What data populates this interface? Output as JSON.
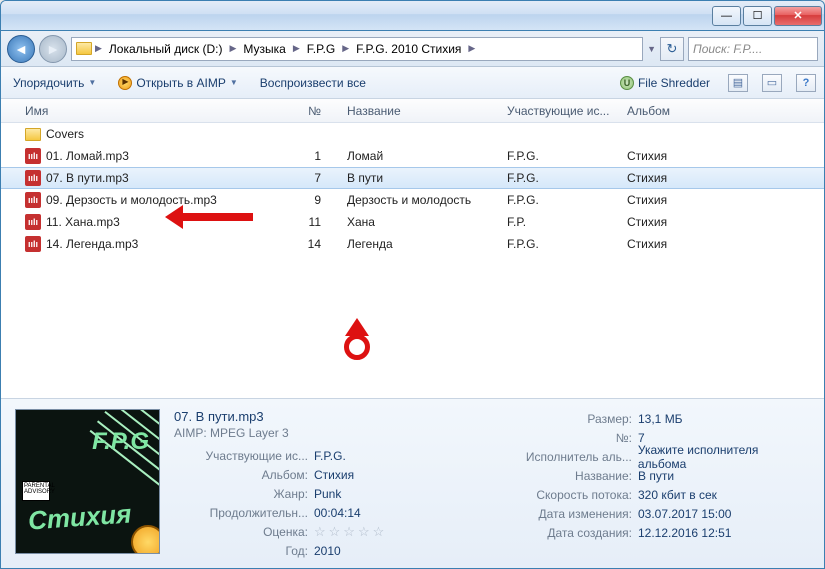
{
  "titlebar": {
    "min": "—",
    "max": "☐",
    "close": "✕"
  },
  "nav": {
    "crumbs": [
      "Локальный диск (D:)",
      "Музыка",
      "F.P.G",
      "F.P.G. 2010 Стихия"
    ],
    "search_placeholder": "Поиск: F.P...."
  },
  "toolbar": {
    "organize": "Упорядочить",
    "open_aimp": "Открыть в AIMP",
    "play_all": "Воспроизвести все",
    "file_shredder": "File Shredder"
  },
  "columns": {
    "c1": "Имя",
    "c2": "№",
    "c3": "Название",
    "c4": "Участвующие ис...",
    "c5": "Альбом"
  },
  "rows": [
    {
      "type": "folder",
      "name": "Covers",
      "num": "",
      "title": "",
      "artist": "",
      "album": ""
    },
    {
      "type": "mp3",
      "name": "01. Ломай.mp3",
      "num": "1",
      "title": "Ломай",
      "artist": "F.P.G.",
      "album": "Стихия"
    },
    {
      "type": "mp3",
      "name": "07. В пути.mp3",
      "num": "7",
      "title": "В пути",
      "artist": "F.P.G.",
      "album": "Стихия",
      "selected": true
    },
    {
      "type": "mp3",
      "name": "09. Дерзость и молодость.mp3",
      "num": "9",
      "title": "Дерзость и молодость",
      "artist": "F.P.G.",
      "album": "Стихия"
    },
    {
      "type": "mp3",
      "name": "11. Хана.mp3",
      "num": "11",
      "title": "Хана",
      "artist": "F.P.",
      "album": "Стихия"
    },
    {
      "type": "mp3",
      "name": "14. Легенда.mp3",
      "num": "14",
      "title": "Легенда",
      "artist": "F.P.G.",
      "album": "Стихия"
    }
  ],
  "details": {
    "thumb_band": "F.P.G",
    "thumb_album": "Стихия",
    "thumb_advisory": "PARENTAL ADVISORY",
    "filename": "07. В пути.mp3",
    "filetype": "AIMP: MPEG Layer 3",
    "left": [
      {
        "label": "Участвующие ис...",
        "value": "F.P.G."
      },
      {
        "label": "Альбом:",
        "value": "Стихия"
      },
      {
        "label": "Жанр:",
        "value": "Punk"
      },
      {
        "label": "Продолжительн...",
        "value": "00:04:14"
      },
      {
        "label": "Оценка:",
        "value": "stars"
      },
      {
        "label": "Год:",
        "value": "2010"
      }
    ],
    "right": [
      {
        "label": "Размер:",
        "value": "13,1 МБ"
      },
      {
        "label": "№:",
        "value": "7"
      },
      {
        "label": "Исполнитель аль...",
        "value": "Укажите исполнителя альбома"
      },
      {
        "label": "Название:",
        "value": "В пути"
      },
      {
        "label": "Скорость потока:",
        "value": "320 кбит в сек"
      },
      {
        "label": "Дата изменения:",
        "value": "03.07.2017 15:00"
      },
      {
        "label": "Дата создания:",
        "value": "12.12.2016 12:51"
      }
    ]
  }
}
